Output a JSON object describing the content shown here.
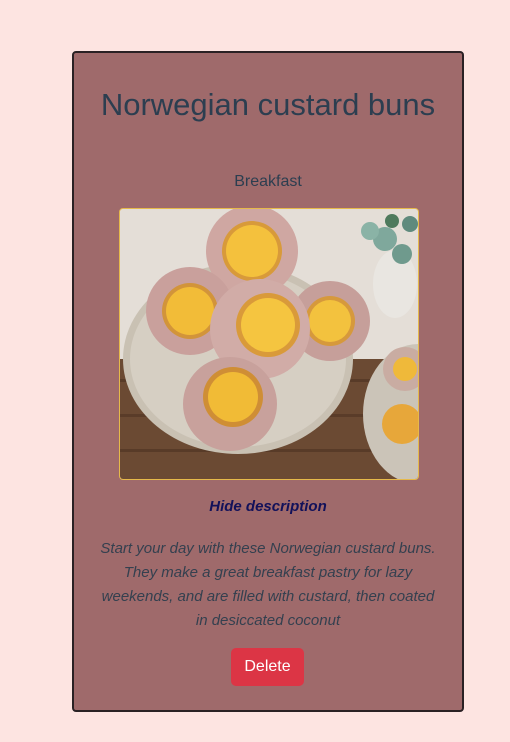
{
  "recipe": {
    "title": "Norwegian custard buns",
    "category": "Breakfast",
    "toggle_label": "Hide description",
    "description": "Start your day with these Norwegian custard buns. They make a great breakfast pastry for lazy weekends, and are filled with custard, then coated in desiccated coconut",
    "delete_label": "Delete"
  },
  "colors": {
    "page_background": "#fde4e1",
    "card_background": "#9f6a6b",
    "title_text": "#2c3e50",
    "link_text": "#12115a",
    "delete_button": "#dc3545"
  }
}
